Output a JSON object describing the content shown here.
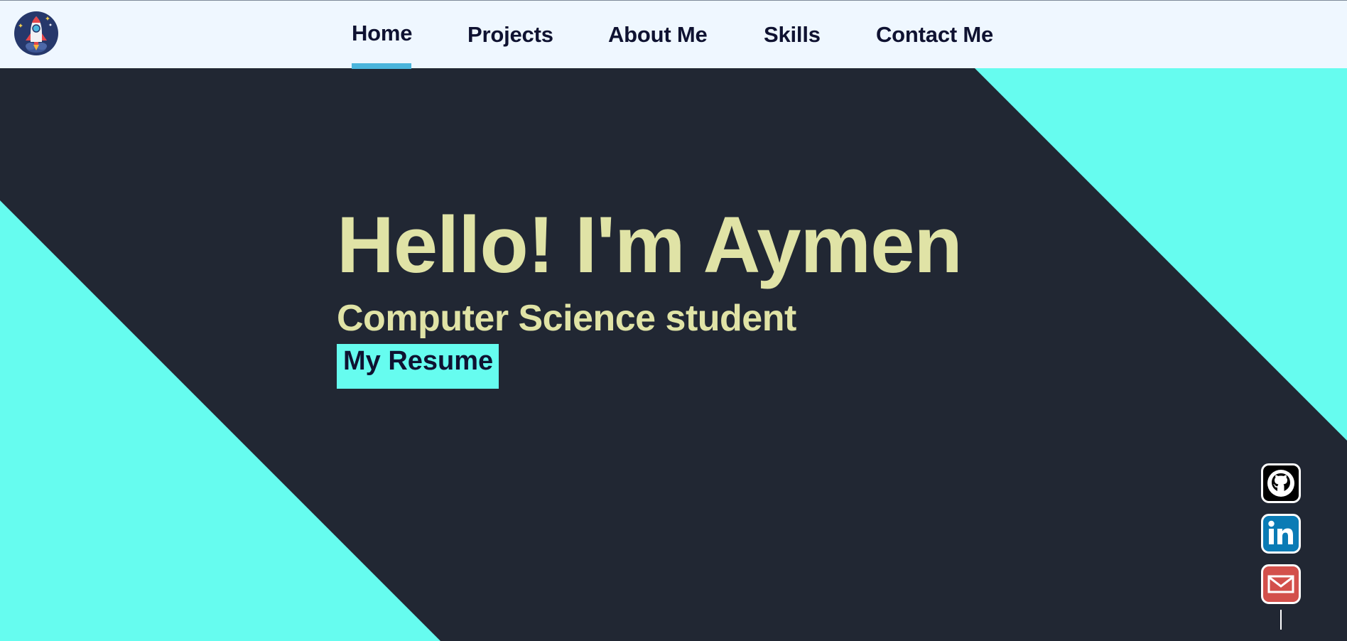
{
  "header": {
    "logo_icon": "rocket-logo-icon",
    "nav": [
      {
        "label": "Home",
        "active": true
      },
      {
        "label": "Projects",
        "active": false
      },
      {
        "label": "About Me",
        "active": false
      },
      {
        "label": "Skills",
        "active": false
      },
      {
        "label": "Contact Me",
        "active": false
      }
    ]
  },
  "hero": {
    "title": "Hello! I'm Aymen",
    "subtitle": "Computer Science student",
    "resume_label": "My Resume"
  },
  "social": [
    {
      "icon": "github-icon"
    },
    {
      "icon": "linkedin-icon"
    },
    {
      "icon": "email-icon"
    }
  ],
  "colors": {
    "topbar": "#eff7ff",
    "background": "#212733",
    "accent": "#66fcef",
    "hero_text": "#e0e3a6",
    "nav_text": "#0f1231",
    "active_underline": "#4bb5dc"
  }
}
